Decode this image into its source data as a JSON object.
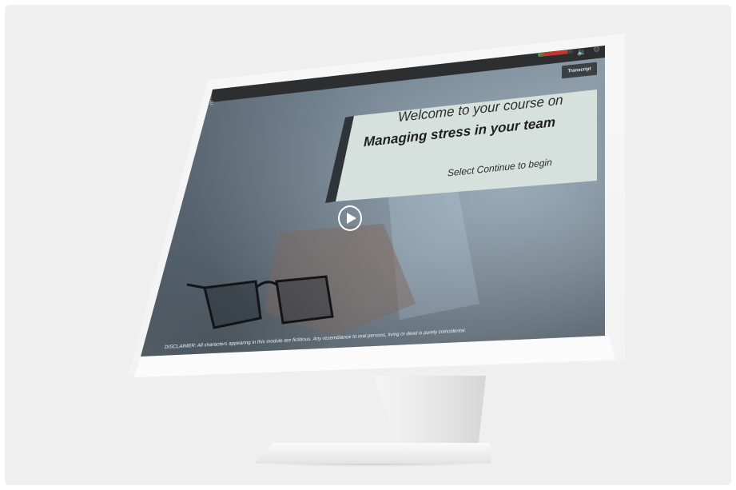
{
  "course": {
    "welcome": "Welcome to your course on",
    "title": "Managing stress in your team",
    "prompt": "Select Continue to begin"
  },
  "toolbar": {
    "transcript_label": "Transcript",
    "progress": 0.85,
    "volume_icon": "volume-icon",
    "settings_icon": "settings-icon",
    "menu_icon": "menu-icon"
  },
  "player": {
    "play_icon": "play-icon"
  },
  "disclaimer": "DISCLAIMER: All characters appearing in this module are fictitious. Any resemblance to real persons, living or dead is purely coincidental.",
  "colors": {
    "panel": "#d6e1dd",
    "topbar": "#2d2e30",
    "background": "#efefef"
  }
}
